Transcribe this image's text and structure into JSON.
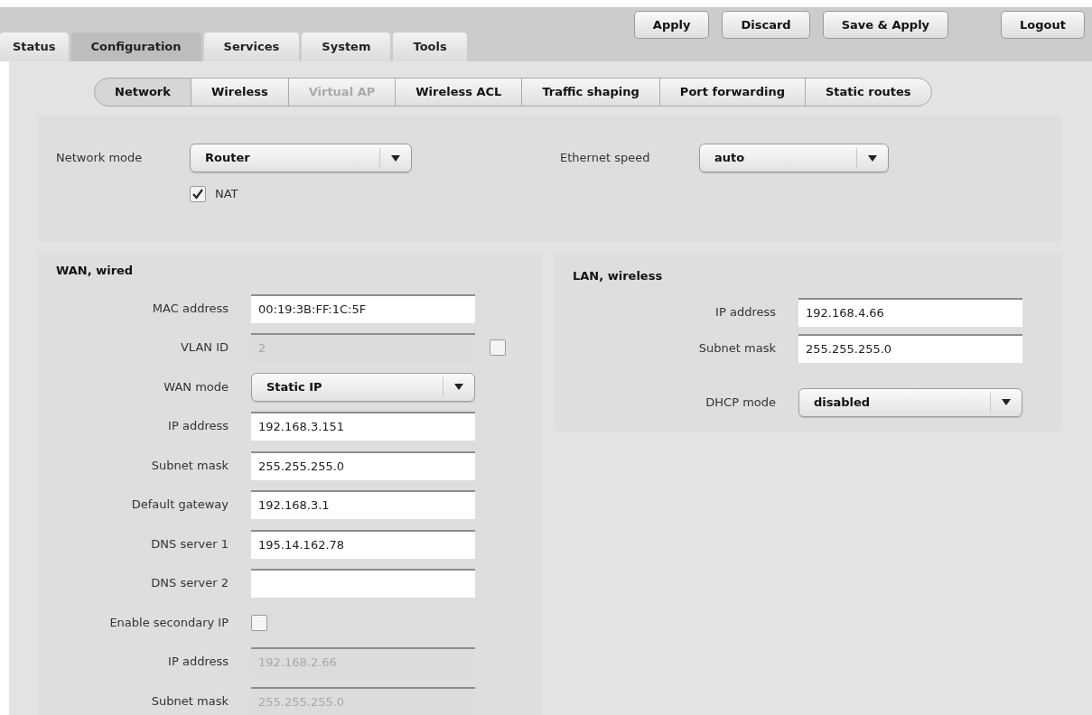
{
  "main_tabs": [
    {
      "label": "Status",
      "selected": false
    },
    {
      "label": "Configuration",
      "selected": true
    },
    {
      "label": "Services",
      "selected": false
    },
    {
      "label": "System",
      "selected": false
    },
    {
      "label": "Tools",
      "selected": false
    }
  ],
  "actions": [
    {
      "label": "Apply"
    },
    {
      "label": "Discard"
    },
    {
      "label": "Save & Apply"
    },
    {
      "label": "Logout"
    }
  ],
  "sub_tabs": [
    {
      "label": "Network",
      "selected": true,
      "disabled": false
    },
    {
      "label": "Wireless",
      "selected": false,
      "disabled": false
    },
    {
      "label": "Virtual AP",
      "selected": false,
      "disabled": true
    },
    {
      "label": "Wireless ACL",
      "selected": false,
      "disabled": false
    },
    {
      "label": "Traffic shaping",
      "selected": false,
      "disabled": false
    },
    {
      "label": "Port forwarding",
      "selected": false,
      "disabled": false
    },
    {
      "label": "Static routes",
      "selected": false,
      "disabled": false
    }
  ],
  "general": {
    "network_mode": {
      "label": "Network mode",
      "value": "Router"
    },
    "nat": {
      "label": "NAT",
      "checked": true
    },
    "ethernet_speed": {
      "label": "Ethernet speed",
      "value": "auto"
    }
  },
  "wan": {
    "title": "WAN, wired",
    "rows": [
      {
        "kind": "text",
        "label": "MAC address",
        "value": "00:19:3B:FF:1C:5F",
        "disabled": false
      },
      {
        "kind": "text_check",
        "label": "VLAN ID",
        "value": "2",
        "disabled": true,
        "checked": false
      },
      {
        "kind": "select",
        "label": "WAN mode",
        "value": "Static IP"
      },
      {
        "kind": "text",
        "label": "IP address",
        "value": "192.168.3.151",
        "disabled": false
      },
      {
        "kind": "text",
        "label": "Subnet mask",
        "value": "255.255.255.0",
        "disabled": false
      },
      {
        "kind": "text",
        "label": "Default gateway",
        "value": "192.168.3.1",
        "disabled": false
      },
      {
        "kind": "text",
        "label": "DNS server 1",
        "value": "195.14.162.78",
        "disabled": false
      },
      {
        "kind": "text",
        "label": "DNS server 2",
        "disabled": false
      },
      {
        "kind": "checkbox",
        "label": "Enable secondary IP",
        "checked": false
      },
      {
        "kind": "text",
        "label": "IP address",
        "value": "192.168.2.66",
        "disabled": true
      },
      {
        "kind": "text",
        "label": "Subnet mask",
        "value": "255.255.255.0",
        "disabled": true
      }
    ]
  },
  "lan": {
    "title": "LAN, wireless",
    "rows": [
      {
        "kind": "text",
        "label": "IP address",
        "value": "192.168.4.66",
        "disabled": false
      },
      {
        "kind": "text",
        "label": "Subnet mask",
        "value": "255.255.255.0",
        "disabled": false
      },
      {
        "kind": "select",
        "label": "DHCP mode",
        "value": "disabled"
      }
    ]
  }
}
